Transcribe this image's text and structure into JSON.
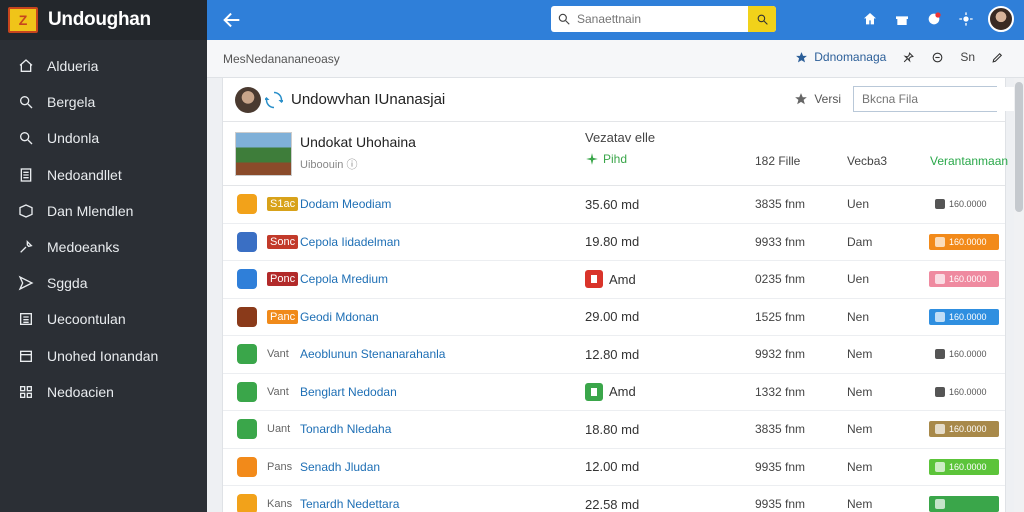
{
  "app": {
    "name": "Undoughan",
    "logo_glyph": "Z"
  },
  "colors": {
    "topbar": "#2f7fd9",
    "sidebar": "#2b2f35",
    "accent_yellow": "#f1d21a",
    "link": "#1e6fb5",
    "green": "#3aa64a"
  },
  "sidebar": {
    "items": [
      {
        "label": "Aldueria",
        "icon": "home-icon"
      },
      {
        "label": "Bergela",
        "icon": "search-icon"
      },
      {
        "label": "Undonla",
        "icon": "search-icon"
      },
      {
        "label": "Nedoandllet",
        "icon": "document-icon"
      },
      {
        "label": "Dan Mlendlen",
        "icon": "package-icon"
      },
      {
        "label": "Medoeanks",
        "icon": "tools-icon"
      },
      {
        "label": "Sggda",
        "icon": "send-icon"
      },
      {
        "label": "Uecoontulan",
        "icon": "list-icon"
      },
      {
        "label": "Unohed Ionandan",
        "icon": "calendar-icon"
      },
      {
        "label": "Nedoacien",
        "icon": "grid-icon"
      }
    ]
  },
  "topbar": {
    "search_placeholder": "Sanaettnain",
    "icons": [
      "home-icon",
      "gift-icon",
      "notification-icon",
      "settings-icon"
    ]
  },
  "breadcrumb": {
    "text": "MesNedanananeoasy",
    "actions": [
      {
        "label": "Ddnomanaga",
        "icon": "star-icon"
      },
      {
        "label": "",
        "icon": "pin-icon"
      },
      {
        "label": "",
        "icon": "info-icon"
      },
      {
        "label": "Sn",
        "icon": ""
      },
      {
        "label": "",
        "icon": "edit-icon"
      }
    ]
  },
  "panel": {
    "title": "Undowvhan IUnanasjai",
    "favorite_label": "Versi",
    "file_search_placeholder": "Bkcna Fila"
  },
  "feature": {
    "title": "Undokat Uhohaina",
    "subtitle": "Uiboouin",
    "col_title": "Vezatav elle",
    "pill_label": "Pihd",
    "h3": "182 Fille",
    "h4": "Vecba3",
    "h5": "Verantanmaan"
  },
  "rows": [
    {
      "tag": "S1ac",
      "name": "Dodam Meodiam",
      "size": "35.60 md",
      "time": "3835 fnm",
      "state": "Uen",
      "badge": "160.0000",
      "icon_color": "#f2a21a",
      "tag_color": "#d8a21a",
      "badge_color": "",
      "mini_color": ""
    },
    {
      "tag": "Sonc",
      "name": "Cepola Iidadelman",
      "size": "19.80 md",
      "time": "9933 fnm",
      "state": "Dam",
      "badge": "160.0000",
      "icon_color": "#3a6fc4",
      "tag_color": "#c23a2a",
      "badge_color": "#f28a1a",
      "mini_color": ""
    },
    {
      "tag": "Ponc",
      "name": "Cepola Mredium",
      "size": "Amd",
      "time": "0235 fnm",
      "state": "Uen",
      "badge": "160.0000",
      "icon_color": "#2f7fd9",
      "tag_color": "#b22a2a",
      "badge_color": "#ef8aa0",
      "mini_color": "#d9342a"
    },
    {
      "tag": "Panc",
      "name": "Geodi Mdonan",
      "size": "29.00 md",
      "time": "1525 fnm",
      "state": "Nen",
      "badge": "160.0000",
      "icon_color": "#8a3a1a",
      "tag_color": "#f08a1a",
      "badge_color": "#2f8fe0",
      "mini_color": ""
    },
    {
      "tag": "Vant",
      "name": "Aeoblunun Stenanarahanla",
      "size": "12.80 md",
      "time": "9932 fnm",
      "state": "Nem",
      "badge": "160.0000",
      "icon_color": "#3aa64a",
      "tag_color": "",
      "badge_color": "",
      "mini_color": ""
    },
    {
      "tag": "Vant",
      "name": "Benglart Nedodan",
      "size": "Amd",
      "time": "1332 fnm",
      "state": "Nem",
      "badge": "160.0000",
      "icon_color": "#3aa64a",
      "tag_color": "",
      "badge_color": "",
      "mini_color": "#3aa64a"
    },
    {
      "tag": "Uant",
      "name": "Tonardh Nledaha",
      "size": "18.80 md",
      "time": "3835 fnm",
      "state": "Nem",
      "badge": "160.0000",
      "icon_color": "#3aa64a",
      "tag_color": "",
      "badge_color": "#a8894a",
      "mini_color": ""
    },
    {
      "tag": "Pans",
      "name": "Senadh Jludan",
      "size": "12.00 md",
      "time": "9935 fnm",
      "state": "Nem",
      "badge": "160.0000",
      "icon_color": "#f28a1a",
      "tag_color": "",
      "badge_color": "#5cc43a",
      "mini_color": ""
    },
    {
      "tag": "Kans",
      "name": "Tenardh Nedettara",
      "size": "22.58 md",
      "time": "9935 fnm",
      "state": "Nem",
      "badge": "",
      "icon_color": "#f2a21a",
      "tag_color": "",
      "badge_color": "#3aa64a",
      "mini_color": ""
    }
  ]
}
